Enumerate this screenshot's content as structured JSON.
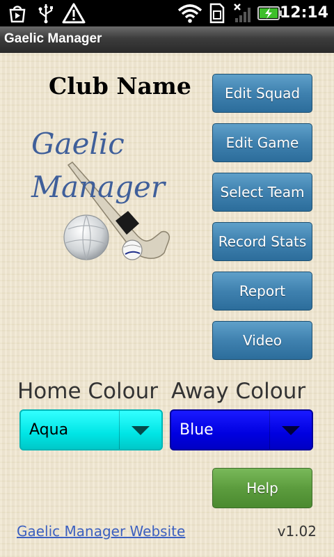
{
  "status_bar": {
    "time": "12:14",
    "icons": [
      "play-store-icon",
      "usb-icon",
      "warning-icon",
      "wifi-icon",
      "sim-card-icon",
      "no-signal-icon",
      "battery-charging-icon"
    ]
  },
  "title_bar": {
    "title": "Gaelic Manager"
  },
  "main": {
    "club_name": "Club Name",
    "logo_text_line1": "Gaelic",
    "logo_text_line2": "Manager",
    "buttons": [
      {
        "label": "Edit Squad"
      },
      {
        "label": "Edit Game"
      },
      {
        "label": "Select Team"
      },
      {
        "label": "Record Stats"
      },
      {
        "label": "Report"
      },
      {
        "label": "Video"
      }
    ],
    "home_colour": {
      "label": "Home Colour",
      "value": "Aqua",
      "color": "#00e5e5"
    },
    "away_colour": {
      "label": "Away Colour",
      "value": "Blue",
      "color": "#0000e0"
    },
    "help_label": "Help",
    "website_link": "Gaelic Manager Website",
    "version": "v1.02"
  },
  "colors": {
    "button_blue": "#3f81af",
    "help_green": "#5c9c3e",
    "background": "#efe6cf",
    "link": "#3c60c0"
  }
}
